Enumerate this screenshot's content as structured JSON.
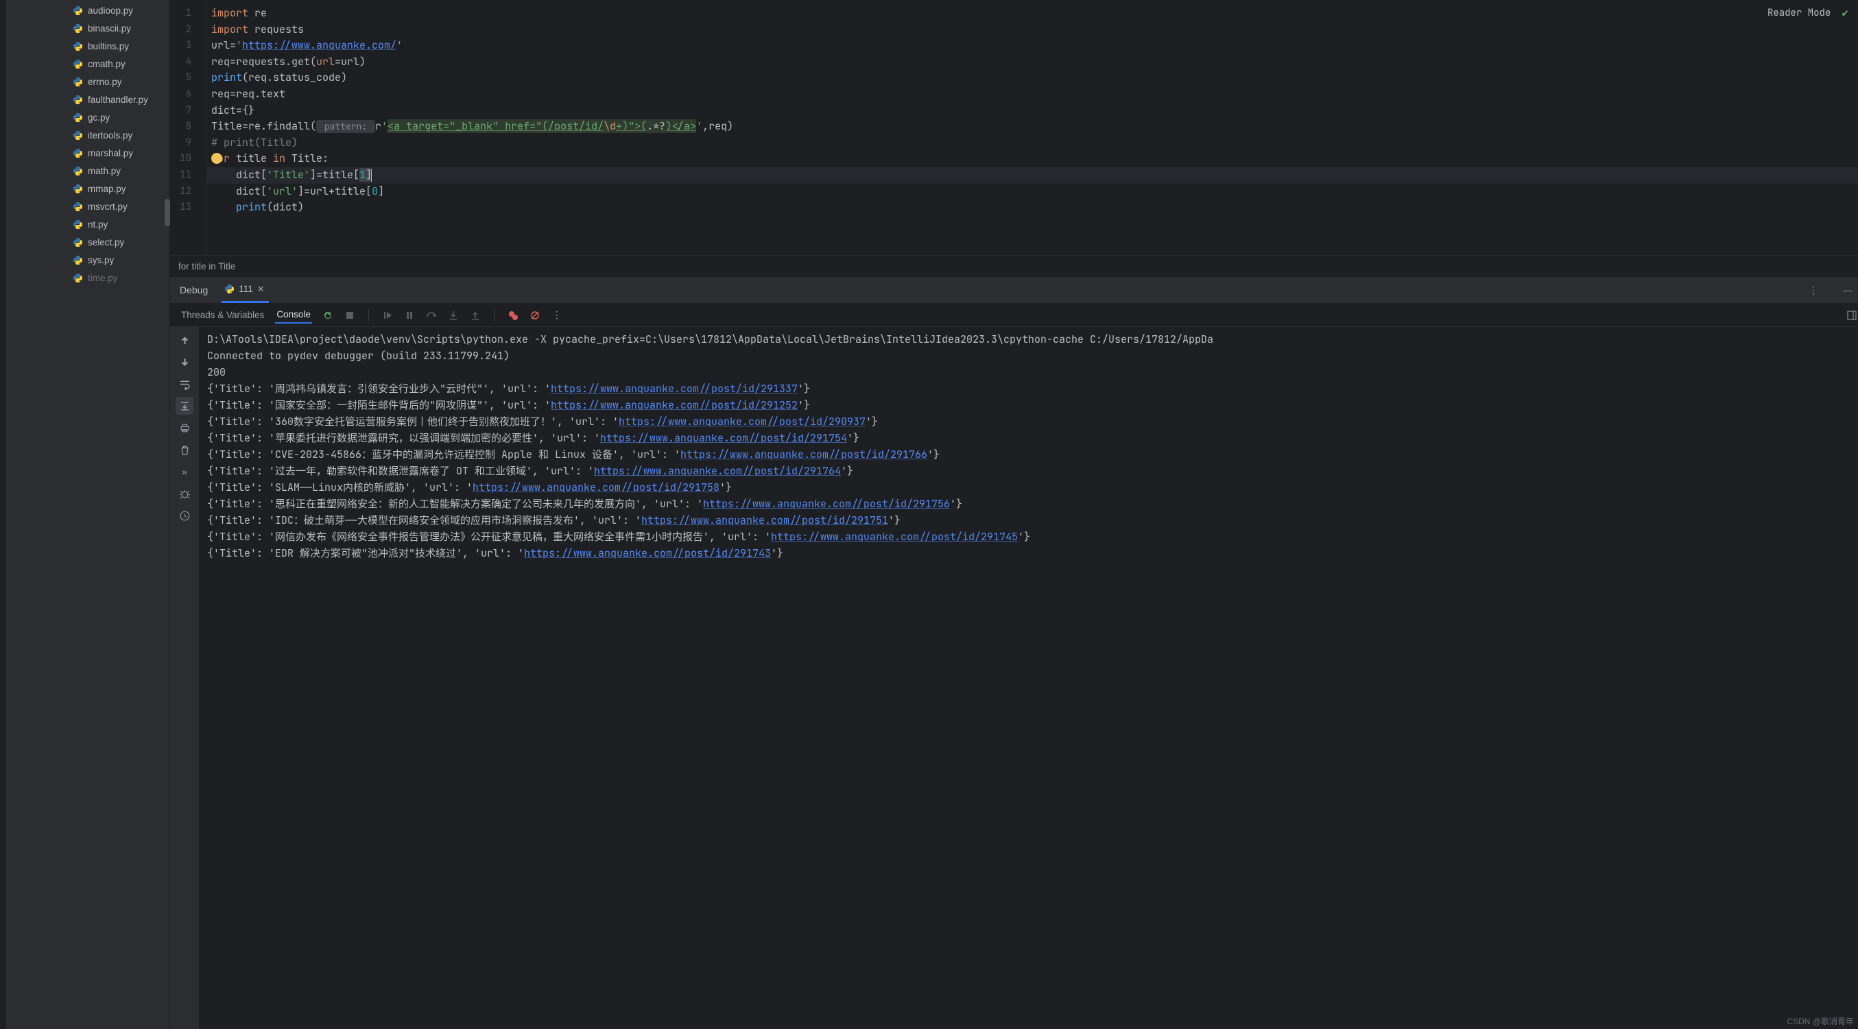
{
  "sidebar": {
    "files": [
      {
        "label": "audioop.py",
        "cut": false
      },
      {
        "label": "binascii.py",
        "cut": false
      },
      {
        "label": "builtins.py",
        "cut": false
      },
      {
        "label": "cmath.py",
        "cut": false
      },
      {
        "label": "errno.py",
        "cut": false
      },
      {
        "label": "faulthandler.py",
        "cut": false
      },
      {
        "label": "gc.py",
        "cut": false
      },
      {
        "label": "itertools.py",
        "cut": false
      },
      {
        "label": "marshal.py",
        "cut": false
      },
      {
        "label": "math.py",
        "cut": false
      },
      {
        "label": "mmap.py",
        "cut": false
      },
      {
        "label": "msvcrt.py",
        "cut": false
      },
      {
        "label": "nt.py",
        "cut": false
      },
      {
        "label": "select.py",
        "cut": false
      },
      {
        "label": "sys.py",
        "cut": false
      },
      {
        "label": "time.py",
        "cut": true
      }
    ]
  },
  "editor": {
    "reader_mode": "Reader Mode",
    "breadcrumb": "for title in Title",
    "lines": {
      "l1": {
        "kw1": "import ",
        "rest": "re"
      },
      "l2": {
        "kw1": "import ",
        "rest": "requests"
      },
      "l3": {
        "a": "url=",
        "q1": "'",
        "url": "https://www.anquanke.com/",
        "q2": "'"
      },
      "l4": {
        "a": "req=requests.get(",
        "p": "url",
        "b": "=url)"
      },
      "l5": {
        "fn": "print",
        "a": "(req.status_code)"
      },
      "l6": {
        "a": "req=req.text"
      },
      "l7": {
        "a": "dict={}"
      },
      "l8": {
        "a": "Title=re.findall(",
        "hint": " pattern: ",
        "p1": "r",
        "q1": "'",
        "rx1": "<a target=\"_blank\" href=\"(/post/id/",
        "rxesc": "\\d",
        "rx2": "+)\">(",
        "rxgrp": ".*?",
        "rx3": ")</a>",
        "q2": "'",
        "b": ",req)"
      },
      "l9": {
        "c": "# print(Title)"
      },
      "l10": {
        "kw1": "for",
        "a": " title ",
        "kw2": "in",
        "b": " Title:"
      },
      "l11": {
        "in": "    ",
        "a": "dict[",
        "s": "'Title'",
        "b": "]=title[",
        "n": "1",
        "c": "]"
      },
      "l12": {
        "in": "    ",
        "a": "dict[",
        "s": "'url'",
        "b": "]=url+title[",
        "n": "0",
        "c": "]"
      },
      "l13": {
        "in": "    ",
        "fn": "print",
        "a": "(dict)"
      }
    }
  },
  "debug": {
    "title": "Debug",
    "tab_label": "111"
  },
  "toolbar": {
    "tab1": "Threads & Variables",
    "tab2": "Console"
  },
  "console": {
    "launch": "D:\\ATools\\IDEA\\project\\daode\\venv\\Scripts\\python.exe -X pycache_prefix=C:\\Users\\17812\\AppData\\Local\\JetBrains\\IntelliJIdea2023.3\\cpython-cache C:/Users/17812/AppDa",
    "connect": "Connected to pydev debugger (build 233.11799.241)",
    "status": "200",
    "rows": [
      {
        "pre": "{'Title': '周鸿祎乌镇发言：引领安全行业步入\"云时代\"', 'url': '",
        "url": "https://www.anquanke.com//post/id/291337",
        "post": "'}"
      },
      {
        "pre": "{'Title': '国家安全部：一封陌生邮件背后的\"网攻阴谋\"', 'url': '",
        "url": "https://www.anquanke.com//post/id/291252",
        "post": "'}"
      },
      {
        "pre": "{'Title': '360数字安全托管运营服务案例丨他们终于告别熬夜加班了！', 'url': '",
        "url": "https://www.anquanke.com//post/id/290937",
        "post": "'}"
      },
      {
        "pre": "{'Title': '苹果委托进行数据泄露研究，以强调端到端加密的必要性', 'url': '",
        "url": "https://www.anquanke.com//post/id/291754",
        "post": "'}"
      },
      {
        "pre": "{'Title': 'CVE-2023-45866：蓝牙中的漏洞允许远程控制 Apple 和 Linux 设备', 'url': '",
        "url": "https://www.anquanke.com//post/id/291766",
        "post": "'}"
      },
      {
        "pre": "{'Title': '过去一年，勒索软件和数据泄露席卷了 OT 和工业领域', 'url': '",
        "url": "https://www.anquanke.com//post/id/291764",
        "post": "'}"
      },
      {
        "pre": "{'Title': 'SLAM——Linux内核的新威胁', 'url': '",
        "url": "https://www.anquanke.com//post/id/291758",
        "post": "'}"
      },
      {
        "pre": "{'Title': '思科正在重塑网络安全：新的人工智能解决方案确定了公司未来几年的发展方向', 'url': '",
        "url": "https://www.anquanke.com//post/id/291756",
        "post": "'}"
      },
      {
        "pre": "{'Title': 'IDC：破土萌芽——大模型在网络安全领域的应用市场洞察报告发布', 'url': '",
        "url": "https://www.anquanke.com//post/id/291751",
        "post": "'}"
      },
      {
        "pre": "{'Title': '网信办发布《网络安全事件报告管理办法》公开征求意见稿，重大网络安全事件需1小时内报告', 'url': '",
        "url": "https://www.anquanke.com//post/id/291745",
        "post": "'}"
      },
      {
        "pre": "{'Title': 'EDR 解决方案可被\"池冲派对\"技术绕过', 'url': '",
        "url": "https://www.anquanke.com//post/id/291743",
        "post": "'}"
      }
    ]
  },
  "watermark": "CSDN @歌消青年"
}
